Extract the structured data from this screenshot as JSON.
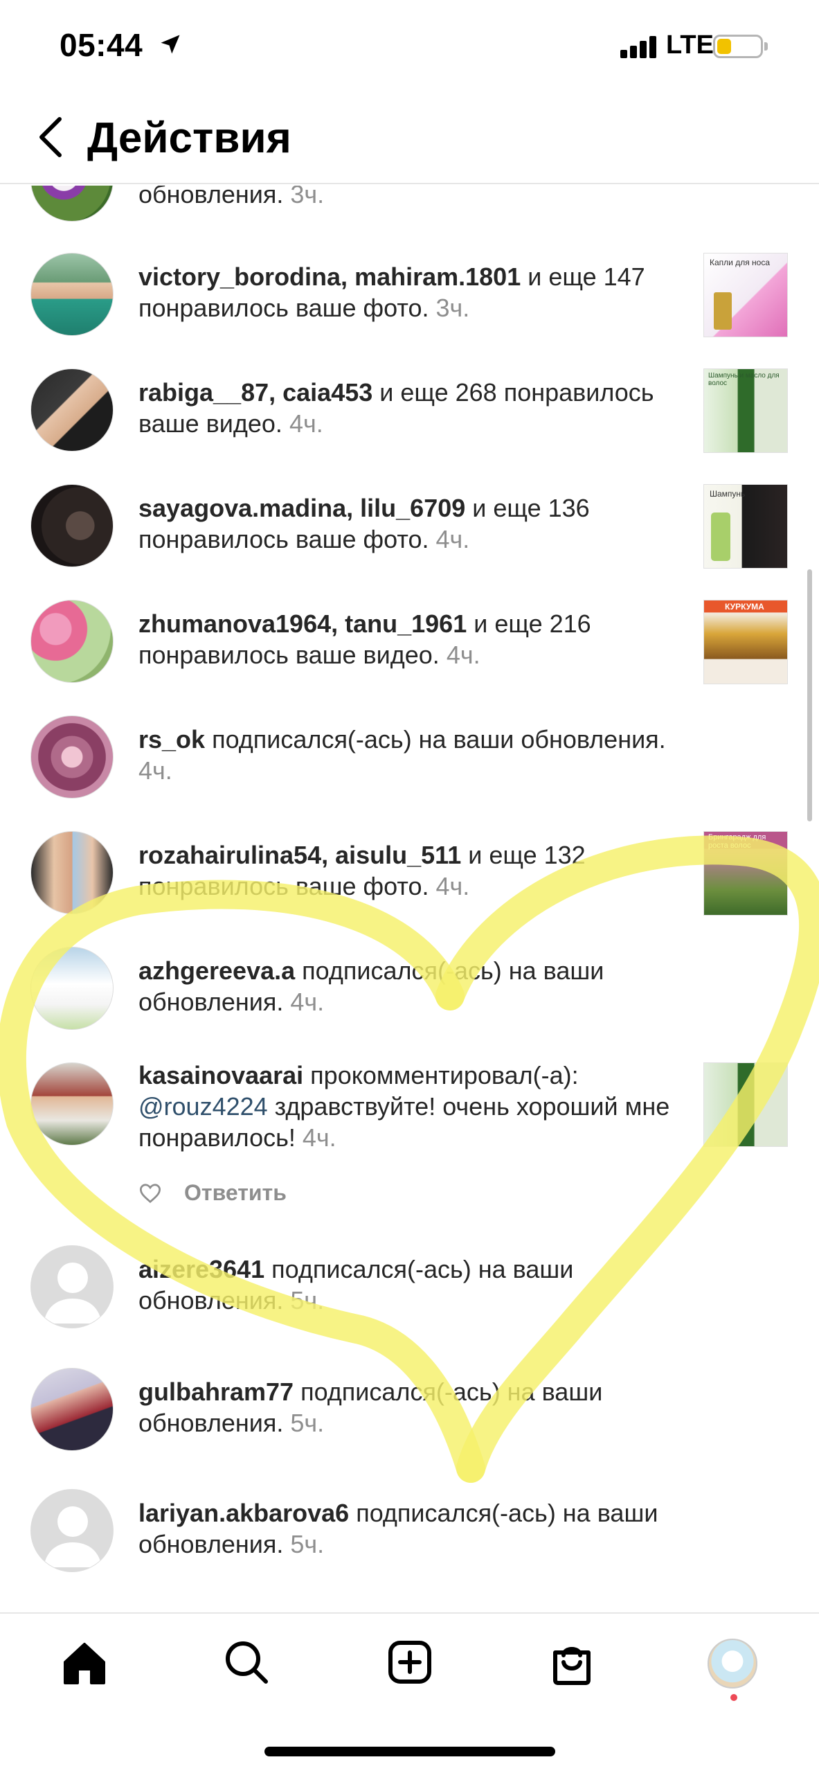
{
  "status_bar": {
    "time": "05:44",
    "network": "LTE",
    "battery_color": "#f2c200"
  },
  "header": {
    "title": "Действия",
    "back_icon": "chevron-left-icon"
  },
  "activities": [
    {
      "text": "обновления.",
      "time": "3ч."
    },
    {
      "users": "victory_borodina, mahiram.1801",
      "text": " и еще 147 понравилось ваше фото.",
      "time": "3ч.",
      "thumb": "Капли для носа"
    },
    {
      "users": "rabiga__87, caia453",
      "text": " и еще 268 понравилось ваше видео.",
      "time": "4ч.",
      "thumb": "Шампунь и масло для волос"
    },
    {
      "users": "sayagova.madina, lilu_6709",
      "text": " и еще 136 понравилось ваше фото.",
      "time": "4ч.",
      "thumb": "Шампунь"
    },
    {
      "users": "zhumanova1964, tanu_1961",
      "text": " и еще 216 понравилось ваше видео.",
      "time": "4ч.",
      "thumb": "КУРКУМА"
    },
    {
      "users": "rs_ok",
      "text": " подписался(-ась) на ваши обновления.",
      "time": "4ч."
    },
    {
      "users": "rozahairulina54, aisulu_511",
      "text": " и еще 132 понравилось ваше фото.",
      "time": "4ч.",
      "thumb": "Брингарадж для роста волос"
    },
    {
      "users": "azhgereeva.a",
      "text": " подписался(-ась) на ваши обновления.",
      "time": "4ч."
    },
    {
      "users": "kasainovaarai",
      "text": " прокомментировал(-а): ",
      "mention": "@rouz4224",
      "comment": " здравствуйте! очень хороший мне понравилось!",
      "time": "4ч.",
      "reply": "Ответить"
    },
    {
      "users": "aizere3641",
      "text": " подписался(-ась) на ваши обновления.",
      "time": "5ч."
    },
    {
      "users": "gulbahram77",
      "text": " подписался(-ась) на ваши обновления.",
      "time": "5ч."
    },
    {
      "users": "lariyan.akbarova6",
      "text": " подписался(-ась) на ваши обновления.",
      "time": "5ч."
    }
  ],
  "thumb_text": {
    "nose": "Капли для носа",
    "shampoo_oil": "Шампунь и масло для волос",
    "shampoo": "Шампунь",
    "turmeric": "КУРКУМА",
    "bhringaraj": "Брингарадж для роста волос"
  },
  "tabbar": {
    "tabs": [
      "home-icon",
      "search-icon",
      "new-post-icon",
      "shop-icon",
      "profile-avatar"
    ],
    "notification_dot_color": "#ed4956"
  },
  "overlay": {
    "heart_color": "#f5f06a"
  }
}
